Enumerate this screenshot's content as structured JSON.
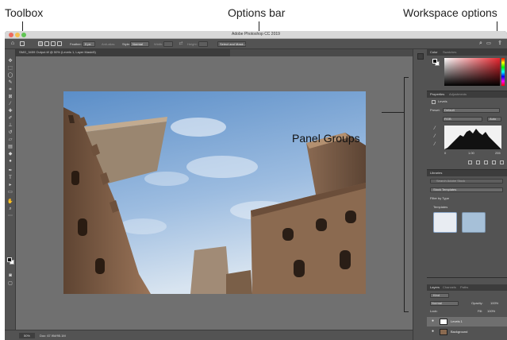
{
  "callouts": {
    "toolbox": "Toolbox",
    "options_bar": "Options bar",
    "workspace_options": "Workspace options",
    "panel_groups": "Panel Groups"
  },
  "app": {
    "title": "Adobe Photoshop CC 2019"
  },
  "options_bar": {
    "feather_label": "Feather:",
    "feather_value": "0 px",
    "antialias_label": "Anti-alias",
    "style_label": "Style:",
    "style_value": "Normal",
    "width_label": "Width:",
    "height_label": "Height:",
    "select_mask_button": "Select and Mask..."
  },
  "document": {
    "tab_label": "SMG_3459 Output.tif @ 50% (Levels 1, Layer Mask/8)",
    "zoom": "50%",
    "doc_size": "Doc: 67.9M/95.1M"
  },
  "panels": {
    "color": {
      "tabs": [
        "Color",
        "Swatches"
      ]
    },
    "properties": {
      "tabs": [
        "Properties",
        "Adjustments"
      ],
      "type_label": "Levels",
      "preset_label": "Preset:",
      "preset_value": "Default",
      "channel_value": "RGB",
      "auto_button": "Auto",
      "input_values": [
        "0",
        "1.00",
        "255"
      ]
    },
    "libraries": {
      "tab": "Libraries",
      "search_placeholder": "Search Adobe Stock",
      "library_name": "Stock Templates",
      "filter_label": "Filter by Type",
      "section_label": "Templates"
    },
    "layers": {
      "tabs": [
        "Layers",
        "Channels",
        "Paths"
      ],
      "kind_label": "Kind",
      "blend_mode": "Normal",
      "opacity_label": "Opacity:",
      "opacity_value": "100%",
      "lock_label": "Lock:",
      "fill_label": "Fill:",
      "fill_value": "100%",
      "items": [
        {
          "name": "Levels 1"
        },
        {
          "name": "Background"
        }
      ]
    }
  },
  "colors": {
    "window_bg": "#4a4a4a",
    "canvas_bg": "#707070",
    "panel_bg": "#535353"
  }
}
